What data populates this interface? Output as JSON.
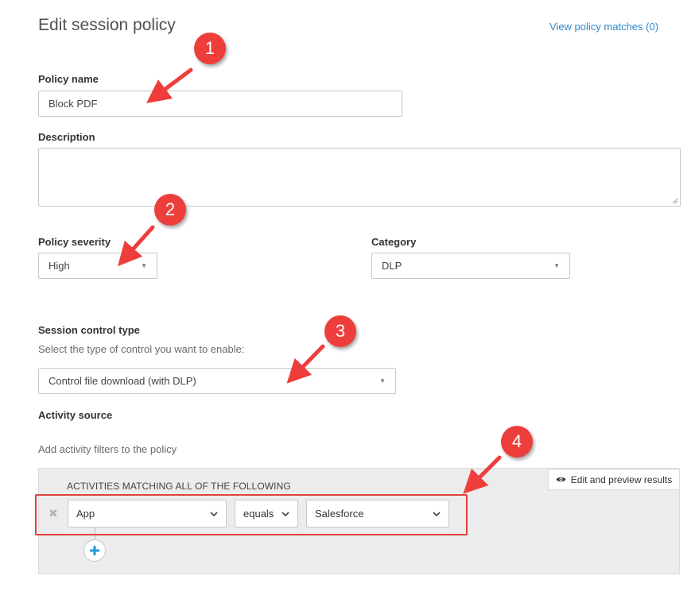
{
  "header": {
    "title": "Edit session policy",
    "matches_link": "View policy matches (0)"
  },
  "policy_name": {
    "label": "Policy name",
    "value": "Block PDF"
  },
  "description": {
    "label": "Description",
    "value": ""
  },
  "severity": {
    "label": "Policy severity",
    "selected": "High"
  },
  "category": {
    "label": "Category",
    "selected": "DLP"
  },
  "session_control": {
    "label": "Session control type",
    "hint": "Select the type of control you want to enable:",
    "selected": "Control file download (with DLP)"
  },
  "activity_source": {
    "label": "Activity source",
    "hint": "Add activity filters to the policy",
    "panel_title": "ACTIVITIES MATCHING ALL OF THE FOLLOWING",
    "preview_button": "Edit and preview results",
    "filter": {
      "field": "App",
      "operator": "equals",
      "value": "Salesforce"
    }
  },
  "annotations": {
    "badges": [
      "1",
      "2",
      "3",
      "4"
    ],
    "color": "#ee3e3b"
  },
  "icons": [
    "eye-icon",
    "remove-x-icon",
    "chevron-down-icon",
    "plus-icon",
    "resize-grip-icon"
  ]
}
